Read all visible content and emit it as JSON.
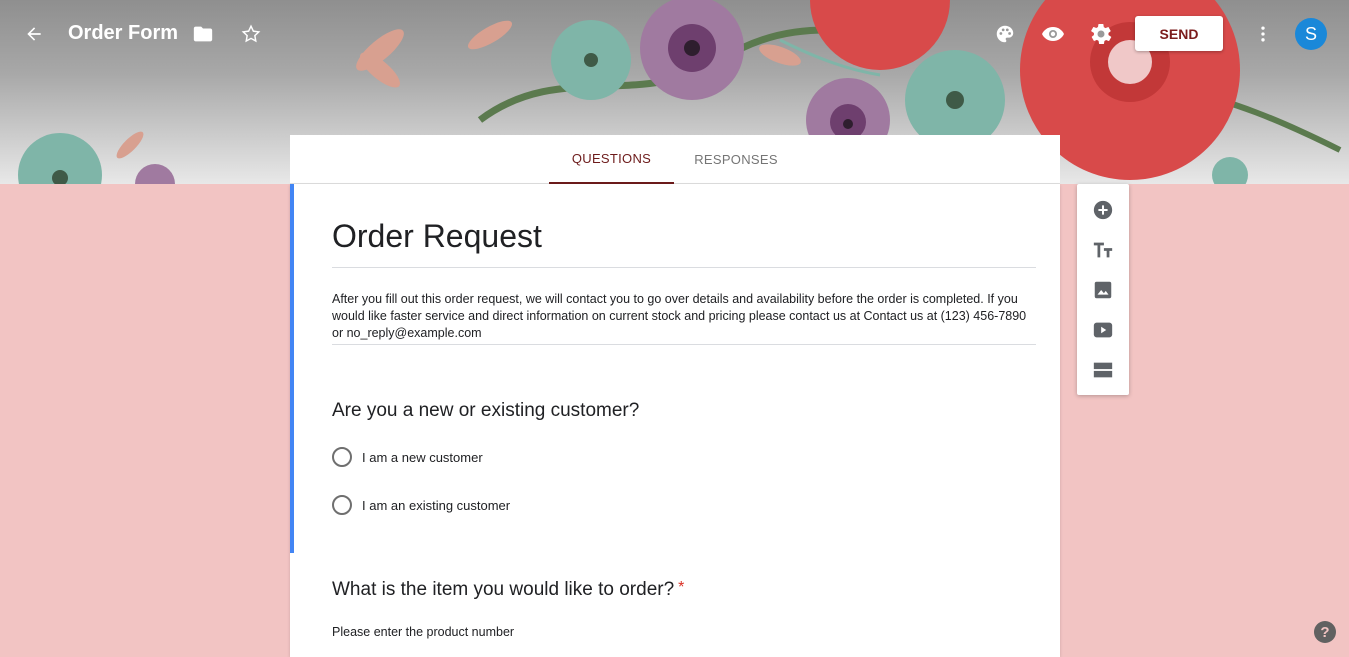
{
  "header": {
    "title": "Order Form",
    "send_label": "SEND",
    "avatar_initial": "S",
    "icons": [
      "back-arrow-icon",
      "folder-icon",
      "star-icon",
      "palette-icon",
      "eye-icon",
      "gear-icon",
      "more-vert-icon"
    ]
  },
  "tabs": [
    {
      "label": "QUESTIONS",
      "active": true
    },
    {
      "label": "RESPONSES",
      "active": false
    }
  ],
  "form": {
    "title": "Order Request",
    "description": "After you fill out this order request, we will contact you to go over details and availability before the order is completed. If you would like faster service and direct information on current stock and pricing please contact us at Contact us at (123) 456-7890 or no_reply@example.com",
    "questions": [
      {
        "title": "Are you a new or existing customer?",
        "required": false,
        "options": [
          "I am a new customer",
          "I am an existing customer"
        ]
      },
      {
        "title": "What is the item you would like to order?",
        "required": true,
        "required_mark": "*",
        "description": "Please enter the product number"
      }
    ]
  },
  "toolbar": {
    "tools": [
      "add-question-icon",
      "add-title-icon",
      "add-image-icon",
      "add-video-icon",
      "add-section-icon"
    ]
  },
  "help_label": "?",
  "colors": {
    "background": "#f2c4c3",
    "accent": "#6d1b1b",
    "card_accent": "#4285f4",
    "avatar": "#1a88d9",
    "required": "#d93025"
  }
}
